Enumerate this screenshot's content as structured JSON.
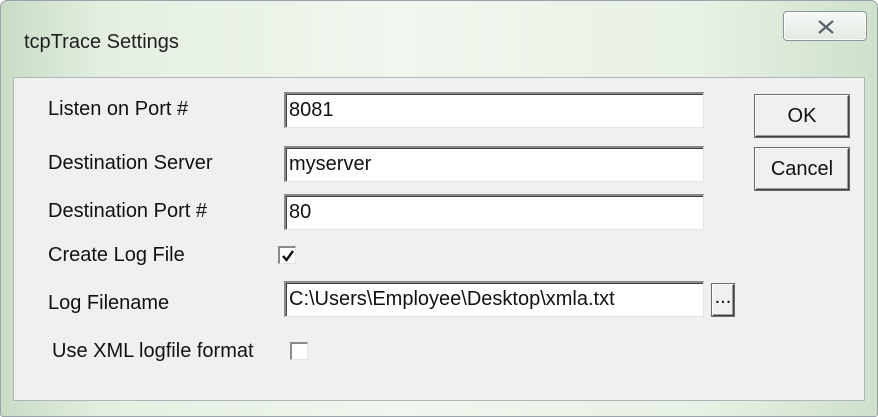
{
  "window": {
    "title": "tcpTrace Settings"
  },
  "form": {
    "listen_port_label": "Listen on Port #",
    "listen_port_value": "8081",
    "dest_server_label": "Destination Server",
    "dest_server_value": "myserver",
    "dest_port_label": "Destination Port #",
    "dest_port_value": "80",
    "create_log_label": "Create Log File",
    "create_log_checked": true,
    "log_filename_label": "Log Filename",
    "log_filename_value": "C:\\Users\\Employee\\Desktop\\xmla.txt",
    "browse_label": "...",
    "xml_format_label": "Use XML logfile format",
    "xml_format_checked": false
  },
  "buttons": {
    "ok_label": "OK",
    "cancel_label": "Cancel"
  },
  "icons": {
    "close": "close-icon",
    "checkmark": "checkmark-icon"
  }
}
